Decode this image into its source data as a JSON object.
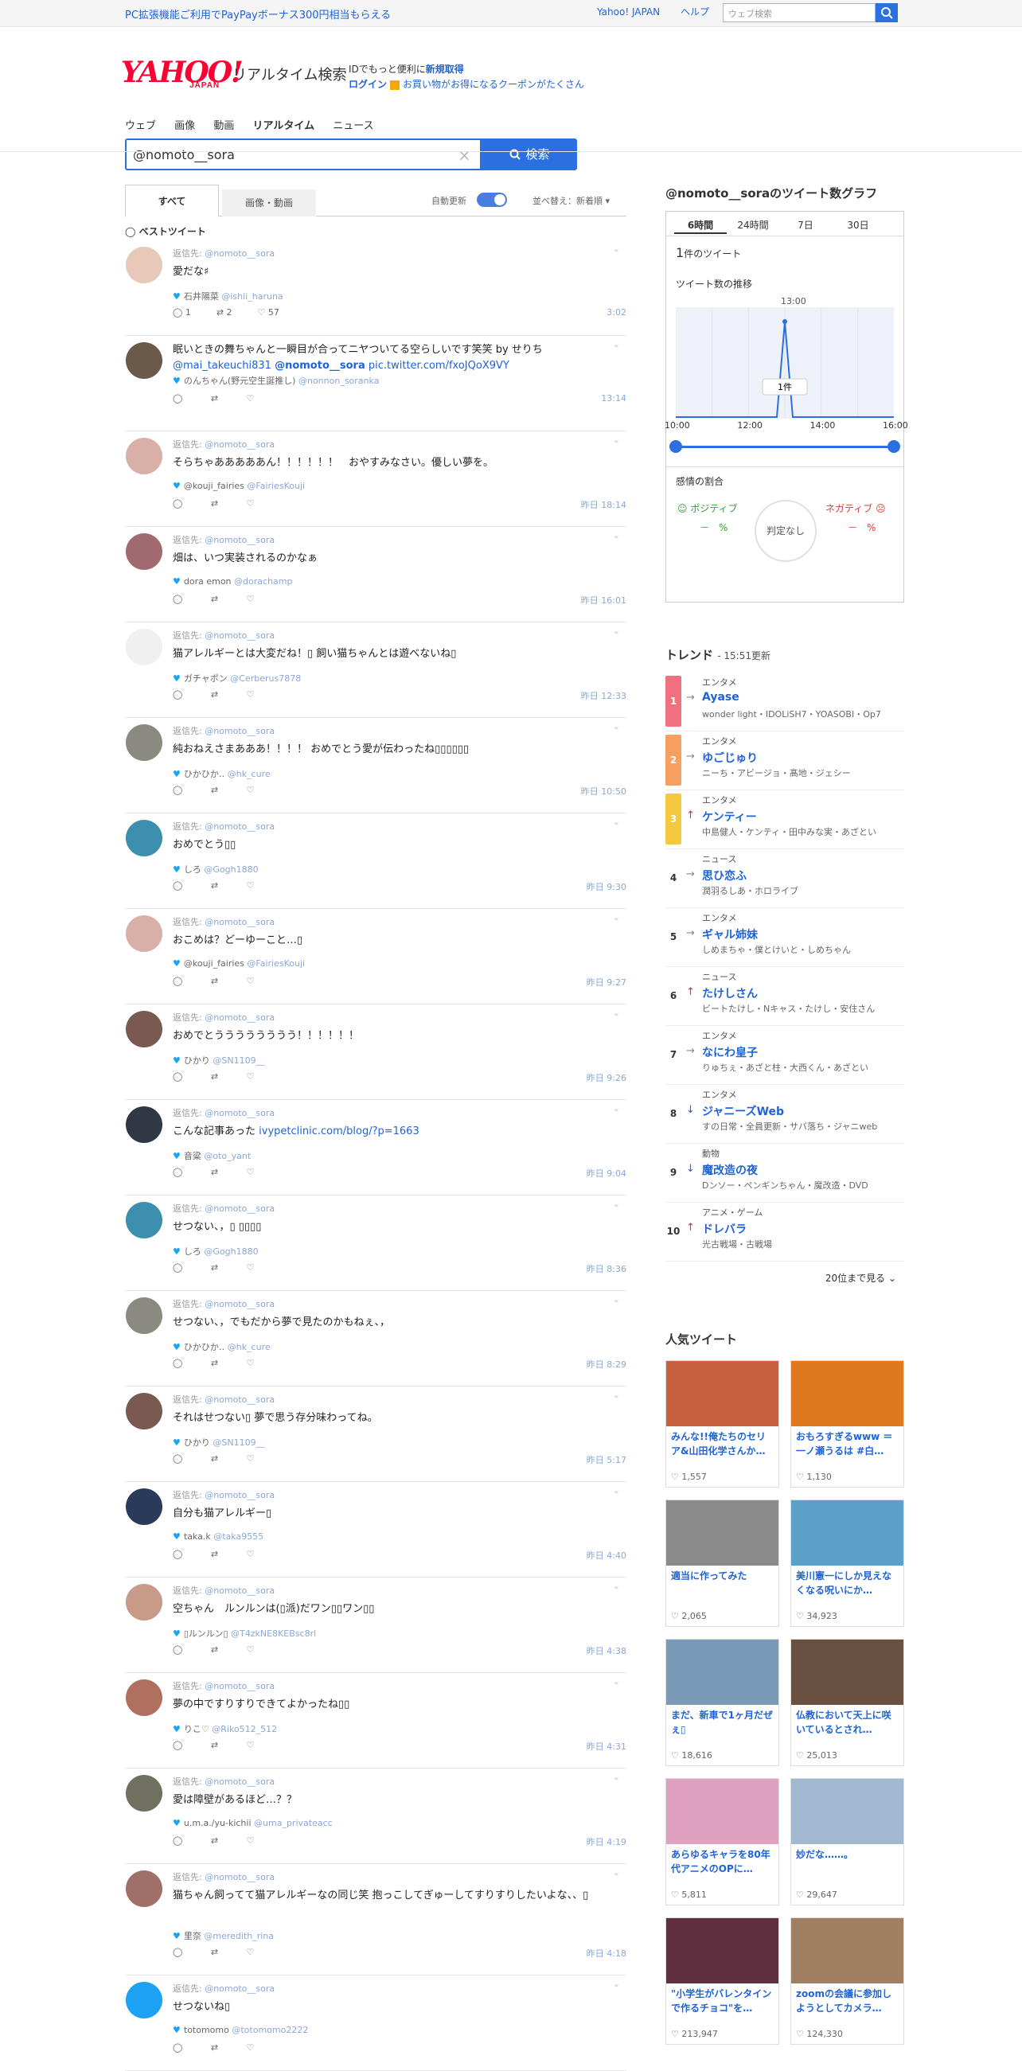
{
  "topbar": {
    "promo": "PC拡張機能ご利用でPayPayボーナス300円相当もらえる",
    "yahoo_japan": "Yahoo! JAPAN",
    "help": "ヘルプ",
    "web_search_placeholder": "ウェブ検索"
  },
  "header": {
    "logo": "YAHOO!",
    "logo_sub": "JAPAN",
    "service": "リアルタイム検索",
    "id_text": "IDでもっと便利に",
    "register": "新規取得",
    "login": "ログイン",
    "coupon": "お買い物がお得になるクーポンがたくさん"
  },
  "nav": {
    "items": [
      "ウェブ",
      "画像",
      "動画",
      "リアルタイム",
      "ニュース"
    ]
  },
  "search": {
    "value": "@nomoto__sora",
    "button": "検索"
  },
  "filters": {
    "tab_all": "すべて",
    "tab_media": "画像・動画",
    "auto": "自動更新",
    "sort": "並べ替え：新着順"
  },
  "best_label": "ベストツイート",
  "tweets": [
    {
      "reply": "返信先: ",
      "to": "@nomoto__sora",
      "text": "愛だな♯",
      "name": "石井陽菜",
      "handle": "@ishii_haruna",
      "reply_count": "1",
      "rt_count": "2",
      "like_count": "57",
      "time": "3:02",
      "avatar": "#e8c8b8"
    },
    {
      "reply": "",
      "to": "",
      "text": "眠いときの舞ちゃんと一瞬目が合ってニヤついてる空らしいです笑笑 by せりち",
      "text2a": "@mai_takeuchi831",
      "text2b": "@nomoto__sora",
      "text2c": "pic.twitter.com/fxoJQoX9VY",
      "name": "のんちゃん(野元空生誕推し)",
      "handle": "@nonnon_soranka",
      "reply_count": "",
      "rt_count": "",
      "like_count": "",
      "time": "13:14",
      "avatar": "#6b5a4a"
    },
    {
      "reply": "返信先: ",
      "to": "@nomoto__sora",
      "text": "そらちゃあああああん！！！！！！　おやすみなさい。優しい夢を。",
      "name": "@kouji_fairies",
      "handle": "@FairiesKouji",
      "reply_count": "",
      "rt_count": "",
      "like_count": "",
      "time": "昨日 18:14",
      "avatar": "#d8b0a8"
    },
    {
      "reply": "返信先: ",
      "to": "@nomoto__sora",
      "text": "畑は、いつ実装されるのかなぁ",
      "name": "dora emon",
      "handle": "@dorachamp",
      "reply_count": "",
      "rt_count": "",
      "like_count": "",
      "time": "昨日 16:01",
      "avatar": "#a06a70"
    },
    {
      "reply": "返信先: ",
      "to": "@nomoto__sora",
      "text": "猫アレルギーとは大変だね！▯ 飼い猫ちゃんとは遊べないね▯",
      "name": "ガチャポン",
      "handle": "@Cerberus7878",
      "reply_count": "",
      "rt_count": "",
      "like_count": "",
      "time": "昨日 12:33",
      "avatar": "#f0f0f0"
    },
    {
      "reply": "返信先: ",
      "to": "@nomoto__sora",
      "text": "純おねえさまあああ！！！！ おめでとう愛が伝わったね▯▯▯▯▯▯",
      "name": "ひかひか‥",
      "handle": "@hk_cure",
      "reply_count": "",
      "rt_count": "",
      "like_count": "",
      "time": "昨日 10:50",
      "avatar": "#8a8a80"
    },
    {
      "reply": "返信先: ",
      "to": "@nomoto__sora",
      "text": "おめでとう▯▯",
      "name": "しろ",
      "handle": "@Gogh1880",
      "reply_count": "",
      "rt_count": "",
      "like_count": "",
      "time": "昨日 9:30",
      "avatar": "#3d8fb0"
    },
    {
      "reply": "返信先: ",
      "to": "@nomoto__sora",
      "text": "おこめは？どーゆーこと…▯",
      "name": "@kouji_fairies",
      "handle": "@FairiesKouji",
      "reply_count": "",
      "rt_count": "",
      "like_count": "",
      "time": "昨日 9:27",
      "avatar": "#d8b0a8"
    },
    {
      "reply": "返信先: ",
      "to": "@nomoto__sora",
      "text": "おめでとうううううううう！！！！！！",
      "name": "ひかり",
      "handle": "@SN1109__",
      "reply_count": "",
      "rt_count": "",
      "like_count": "",
      "time": "昨日 9:26",
      "avatar": "#7a5a50"
    },
    {
      "reply": "返信先: ",
      "to": "@nomoto__sora",
      "text": "こんな記事あった ",
      "link": "ivypetclinic.com/blog/?p=1663",
      "name": "音粱",
      "handle": "@oto_yant",
      "reply_count": "",
      "rt_count": "",
      "like_count": "",
      "time": "昨日 9:04",
      "avatar": "#303844"
    },
    {
      "reply": "返信先: ",
      "to": "@nomoto__sora",
      "text": "せつない、，▯ ▯▯▯▯",
      "name": "しろ",
      "handle": "@Gogh1880",
      "reply_count": "",
      "rt_count": "",
      "like_count": "",
      "time": "昨日 8:36",
      "avatar": "#3d8fb0"
    },
    {
      "reply": "返信先: ",
      "to": "@nomoto__sora",
      "text": "せつない、，でもだから夢で見たのかもねぇ、，",
      "name": "ひかひか‥",
      "handle": "@hk_cure",
      "reply_count": "",
      "rt_count": "",
      "like_count": "",
      "time": "昨日 8:29",
      "avatar": "#8a8a80"
    },
    {
      "reply": "返信先: ",
      "to": "@nomoto__sora",
      "text": "それはせつない▯ 夢で思う存分味わってね。",
      "name": "ひかり",
      "handle": "@SN1109__",
      "reply_count": "",
      "rt_count": "",
      "like_count": "",
      "time": "昨日 5:17",
      "avatar": "#7a5a50"
    },
    {
      "reply": "返信先: ",
      "to": "@nomoto__sora",
      "text": "自分も猫アレルギー▯",
      "name": "taka.k",
      "handle": "@taka9555",
      "reply_count": "",
      "rt_count": "",
      "like_count": "",
      "time": "昨日 4:40",
      "avatar": "#2a3a5a"
    },
    {
      "reply": "返信先: ",
      "to": "@nomoto__sora",
      "text": "空ちゃん　ルンルンは(▯派)だワン▯▯ワン▯▯",
      "name": "▯ルンルン▯",
      "handle": "@T4zkNE8KEBsc8rl",
      "reply_count": "",
      "rt_count": "",
      "like_count": "",
      "time": "昨日 4:38",
      "avatar": "#c89a88"
    },
    {
      "reply": "返信先: ",
      "to": "@nomoto__sora",
      "text": "夢の中ですりすりできてよかったね▯▯",
      "name": "りこ♡",
      "handle": "@Riko512_512",
      "reply_count": "",
      "rt_count": "",
      "like_count": "",
      "time": "昨日 4:31",
      "avatar": "#b07060"
    },
    {
      "reply": "返信先: ",
      "to": "@nomoto__sora",
      "text": "愛は障壁があるほど…？？",
      "name": "u.m.a./yu-kichii",
      "handle": "@uma_privateacc",
      "reply_count": "",
      "rt_count": "",
      "like_count": "",
      "time": "昨日 4:19",
      "avatar": "#707060"
    },
    {
      "reply": "返信先: ",
      "to": "@nomoto__sora",
      "text": "猫ちゃん飼ってて猫アレルギーなの同じ笑 抱っこしてぎゅーしてすりすりしたいよな、、▯",
      "name": "里奈",
      "handle": "@meredith_rina",
      "reply_count": "",
      "rt_count": "",
      "like_count": "",
      "time": "昨日 4:18",
      "avatar": "#a07068"
    },
    {
      "reply": "返信先: ",
      "to": "@nomoto__sora",
      "text": "せつないね▯",
      "name": "totomomo",
      "handle": "@totomomo2222",
      "reply_count": "",
      "rt_count": "",
      "like_count": "",
      "time": "",
      "avatar": "#1da1f2"
    }
  ],
  "graph": {
    "title": "@nomoto__soraのツイート数グラフ",
    "tabs": [
      "6時間",
      "24時間",
      "7日",
      "30日"
    ],
    "count": "1",
    "count_suffix": "件のツイート",
    "trend_label": "ツイート数の推移",
    "peak_time": "13:00",
    "peak_label": "1件",
    "sentiment_label": "感情の割合",
    "positive": "ポジティブ",
    "negative": "ネガティブ",
    "pos_val": "－",
    "neg_val": "－",
    "pct": "%",
    "judge": "判定なし"
  },
  "chart_data": {
    "type": "line",
    "x": [
      "10:00",
      "11:00",
      "12:00",
      "13:00",
      "14:00",
      "15:00",
      "16:00"
    ],
    "values": [
      0,
      0,
      0,
      1,
      0,
      0,
      0
    ],
    "xticks": [
      "10:00",
      "12:00",
      "14:00",
      "16:00"
    ]
  },
  "trend": {
    "title": "トレンド",
    "updated": "15:51更新",
    "items": [
      {
        "rank": "1",
        "cat": "エンタメ",
        "name": "Ayase",
        "sub": "wonder light・IDOLiSH7・YOASOBI・Op7",
        "dir": "→",
        "color": "#f07080",
        "dcol": "#888"
      },
      {
        "rank": "2",
        "cat": "エンタメ",
        "name": "ゆごじゅり",
        "sub": "ニーち・アビージョ・髙地・ジェシー",
        "dir": "→",
        "color": "#f5a060",
        "dcol": "#888"
      },
      {
        "rank": "3",
        "cat": "エンタメ",
        "name": "ケンティー",
        "sub": "中島健人・ケンティ・田中みな実・あざとい",
        "dir": "↑",
        "color": "#f5c842",
        "dcol": "#d33"
      },
      {
        "rank": "4",
        "cat": "ニュース",
        "name": "思ひ恋ふ",
        "sub": "潤羽るしあ・ホロライブ",
        "dir": "→",
        "color": "#fff",
        "dcol": "#888"
      },
      {
        "rank": "5",
        "cat": "エンタメ",
        "name": "ギャル姉妹",
        "sub": "しめまちゃ・僕とけいと・しめちゃん",
        "dir": "→",
        "color": "#fff",
        "dcol": "#888"
      },
      {
        "rank": "6",
        "cat": "ニュース",
        "name": "たけしさん",
        "sub": "ビートたけし・Nキャス・たけし・安住さん",
        "dir": "↑",
        "color": "#fff",
        "dcol": "#d33"
      },
      {
        "rank": "7",
        "cat": "エンタメ",
        "name": "なにわ皇子",
        "sub": "りゅちぇ・あざと柱・大西くん・あざとい",
        "dir": "→",
        "color": "#fff",
        "dcol": "#888"
      },
      {
        "rank": "8",
        "cat": "エンタメ",
        "name": "ジャニーズWeb",
        "sub": "すの日常・全員更新・サバ落ち・ジャニweb",
        "dir": "↓",
        "color": "#fff",
        "dcol": "#1f63d6"
      },
      {
        "rank": "9",
        "cat": "動物",
        "name": "魔改造の夜",
        "sub": "Dンソー・ペンギンちゃん・魔改造・DVD",
        "dir": "↓",
        "color": "#fff",
        "dcol": "#1f63d6"
      },
      {
        "rank": "10",
        "cat": "アニメ・ゲーム",
        "name": "ドレバラ",
        "sub": "光古戦場・古戦場",
        "dir": "↑",
        "color": "#fff",
        "dcol": "#d33"
      }
    ],
    "more": "20位まで見る"
  },
  "popular": {
    "title": "人気ツイート",
    "cards": [
      {
        "text": "みんな!!俺たちのセリア&山田化学さんか…",
        "likes": "1,557",
        "img": "#c86040"
      },
      {
        "text": "おもろすぎるwww ＝一ノ瀬うるは #白…",
        "likes": "1,130",
        "img": "#e07820"
      },
      {
        "text": "適当に作ってみた",
        "likes": "2,065",
        "img": "#8a8a8a"
      },
      {
        "text": "美川憲一にしか見えなくなる呪いにか…",
        "likes": "34,923",
        "img": "#5aa0c8"
      },
      {
        "text": "まだ、新車で1ヶ月だぜぇ▯",
        "likes": "18,616",
        "img": "#7a9ab8"
      },
      {
        "text": "仏教において天上に咲いているとされ…",
        "likes": "25,013",
        "img": "#6a5040"
      },
      {
        "text": "あらゆるキャラを80年代アニメのOPに…",
        "likes": "5,811",
        "img": "#e0a0c0"
      },
      {
        "text": "妙だな……。",
        "likes": "29,647",
        "img": "#a0b8d0"
      },
      {
        "text": "\"小学生がバレンタインで作るチョコ\"を…",
        "likes": "213,947",
        "img": "#603040"
      },
      {
        "text": "zoomの会議に参加しようとしてカメラ…",
        "likes": "124,330",
        "img": "#a08060"
      }
    ]
  }
}
